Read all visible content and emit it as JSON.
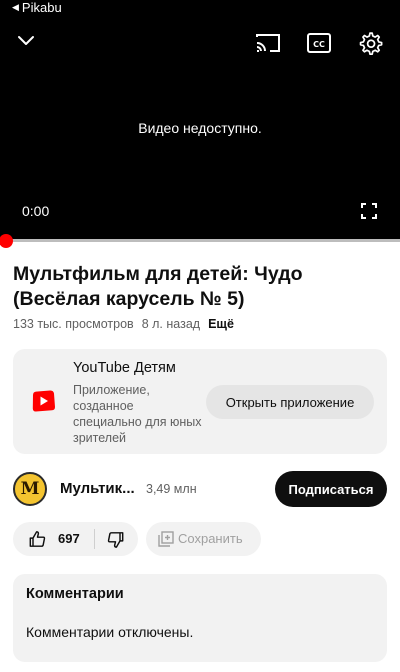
{
  "status_bar": {
    "back_app_label": "Pikabu"
  },
  "player": {
    "unavailable_message": "Видео недоступно.",
    "current_time": "0:00",
    "progress": 0
  },
  "video": {
    "title": "Мультфильм для детей: Чудо (Весёлая карусель № 5)",
    "views": "133 тыс. просмотров",
    "age": "8 л. назад",
    "more_label": "Ещё"
  },
  "youtube_kids_promo": {
    "name": "YouTube Детям",
    "description": "Приложение, созданное специально для юных зрителей",
    "open_button_label": "Открыть приложение"
  },
  "channel": {
    "avatar_letter": "М",
    "name": "Мультик...",
    "subscribers": "3,49 млн",
    "subscribe_label": "Подписаться"
  },
  "actions": {
    "like_count": "697",
    "save_label": "Сохранить"
  },
  "comments": {
    "title": "Комментарии",
    "disabled_message": "Комментарии отключены."
  },
  "colors": {
    "player_bg": "#000000",
    "accent_red": "#ff0000",
    "pill_bg": "#f2f2f2",
    "subscribe_bg": "#0f0f0f"
  }
}
